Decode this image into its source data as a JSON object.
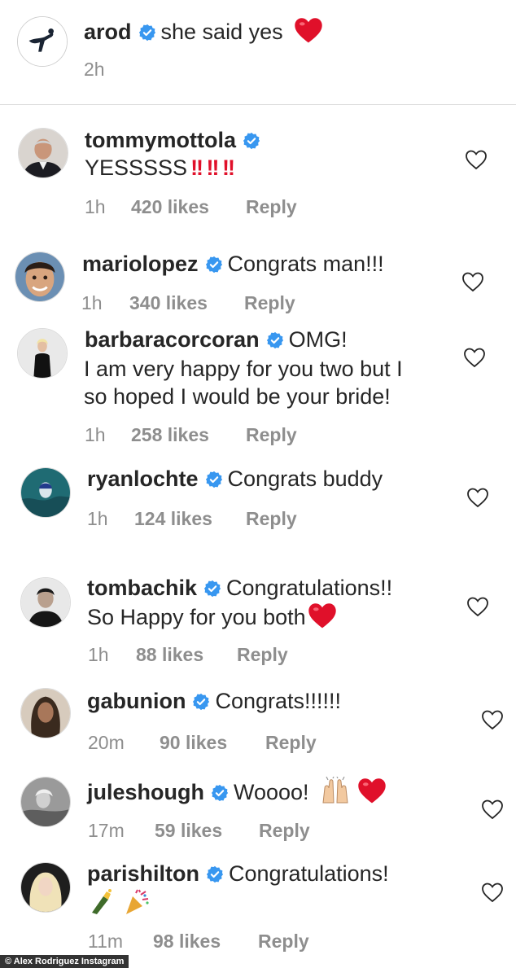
{
  "colors": {
    "verified": "#3897f0",
    "heart_red": "#e0102a",
    "meta_gray": "#8e8e8e",
    "text": "#262626"
  },
  "post": {
    "username": "arod",
    "caption": "she said yes",
    "time": "2h",
    "avatar_icon": "baseball-logo-icon"
  },
  "comments": [
    {
      "username": "tommymottola",
      "text_lines": [
        "YESSSSS"
      ],
      "trail": "!! !! !!",
      "time": "1h",
      "likes": "420 likes",
      "reply": "Reply"
    },
    {
      "username": "mariolopez",
      "text_lines": [
        "Congrats man!!!"
      ],
      "time": "1h",
      "likes": "340 likes",
      "reply": "Reply"
    },
    {
      "username": "barbaracorcoran",
      "text_lines": [
        "OMG!",
        "I am very happy for you two but I",
        "so hoped I would be your bride!"
      ],
      "time": "1h",
      "likes": "258 likes",
      "reply": "Reply"
    },
    {
      "username": "ryanlochte",
      "text_lines": [
        "Congrats buddy"
      ],
      "time": "1h",
      "likes": "124 likes",
      "reply": "Reply"
    },
    {
      "username": "tombachik",
      "text_lines": [
        "Congratulations!!",
        "So Happy for you both"
      ],
      "time": "1h",
      "likes": "88 likes",
      "reply": "Reply"
    },
    {
      "username": "gabunion",
      "text_lines": [
        "Congrats!!!!!!"
      ],
      "time": "20m",
      "likes": "90 likes",
      "reply": "Reply"
    },
    {
      "username": "juleshough",
      "text_lines": [
        "Woooo!"
      ],
      "time": "17m",
      "likes": "59 likes",
      "reply": "Reply"
    },
    {
      "username": "parishilton",
      "text_lines": [
        "Congratulations!"
      ],
      "time": "11m",
      "likes": "98 likes",
      "reply": "Reply"
    }
  ],
  "credit": "© Alex Rodriguez Instagram"
}
